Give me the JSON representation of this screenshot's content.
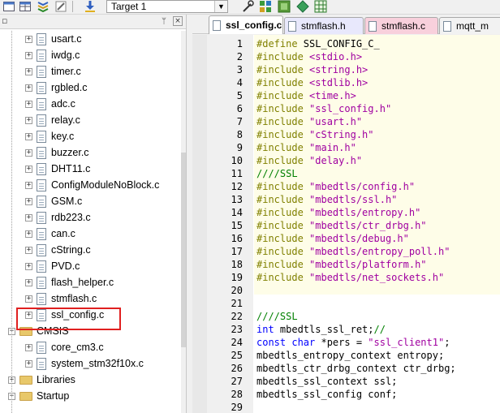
{
  "toolbar": {
    "target_label": "Target 1",
    "dropdown_arrow": "▼"
  },
  "project_panel": {
    "pin_glyph": "ᛘ",
    "close_glyph": "×",
    "tree": [
      {
        "label": "usart.c",
        "kind": "file",
        "level": 2,
        "expander": "+"
      },
      {
        "label": "iwdg.c",
        "kind": "file",
        "level": 2,
        "expander": "+"
      },
      {
        "label": "timer.c",
        "kind": "file",
        "level": 2,
        "expander": "+"
      },
      {
        "label": "rgbled.c",
        "kind": "file",
        "level": 2,
        "expander": "+"
      },
      {
        "label": "adc.c",
        "kind": "file",
        "level": 2,
        "expander": "+"
      },
      {
        "label": "relay.c",
        "kind": "file",
        "level": 2,
        "expander": "+"
      },
      {
        "label": "key.c",
        "kind": "file",
        "level": 2,
        "expander": "+"
      },
      {
        "label": "buzzer.c",
        "kind": "file",
        "level": 2,
        "expander": "+"
      },
      {
        "label": "DHT11.c",
        "kind": "file",
        "level": 2,
        "expander": "+"
      },
      {
        "label": "ConfigModuleNoBlock.c",
        "kind": "file",
        "level": 2,
        "expander": "+"
      },
      {
        "label": "GSM.c",
        "kind": "file",
        "level": 2,
        "expander": "+"
      },
      {
        "label": "rdb223.c",
        "kind": "file",
        "level": 2,
        "expander": "+"
      },
      {
        "label": "can.c",
        "kind": "file",
        "level": 2,
        "expander": "+"
      },
      {
        "label": "cString.c",
        "kind": "file",
        "level": 2,
        "expander": "+"
      },
      {
        "label": "PVD.c",
        "kind": "file",
        "level": 2,
        "expander": "+"
      },
      {
        "label": "flash_helper.c",
        "kind": "file",
        "level": 2,
        "expander": "+"
      },
      {
        "label": "stmflash.c",
        "kind": "file",
        "level": 2,
        "expander": "+"
      },
      {
        "label": "ssl_config.c",
        "kind": "file",
        "level": 2,
        "expander": "+"
      },
      {
        "label": "CMSIS",
        "kind": "folder",
        "level": 1,
        "expander": "−"
      },
      {
        "label": "core_cm3.c",
        "kind": "file",
        "level": 2,
        "expander": "+"
      },
      {
        "label": "system_stm32f10x.c",
        "kind": "file",
        "level": 2,
        "expander": "+"
      },
      {
        "label": "Libraries",
        "kind": "folder",
        "level": 1,
        "expander": "+"
      },
      {
        "label": "Startup",
        "kind": "folder",
        "level": 1,
        "expander": "−"
      }
    ]
  },
  "tabs": [
    {
      "label": "ssl_config.c",
      "active": true,
      "color": "#ffffff"
    },
    {
      "label": "stmflash.h",
      "active": false,
      "color": "#e8e8fc"
    },
    {
      "label": "stmflash.c",
      "active": false,
      "color": "#f8d0dc"
    },
    {
      "label": "mqtt_m",
      "active": false,
      "color": "#f2f2f2"
    }
  ],
  "editor": {
    "lines": [
      {
        "n": "1",
        "parts": [
          [
            "pp",
            "#define "
          ],
          [
            "",
            "SSL_CONFIG_C_"
          ]
        ]
      },
      {
        "n": "2",
        "parts": [
          [
            "pp",
            "#include "
          ],
          [
            "inc",
            "<stdio.h>"
          ]
        ]
      },
      {
        "n": "3",
        "parts": [
          [
            "pp",
            "#include "
          ],
          [
            "inc",
            "<string.h>"
          ]
        ]
      },
      {
        "n": "4",
        "parts": [
          [
            "pp",
            "#include "
          ],
          [
            "inc",
            "<stdlib.h>"
          ]
        ]
      },
      {
        "n": "5",
        "parts": [
          [
            "pp",
            "#include "
          ],
          [
            "inc",
            "<time.h>"
          ]
        ]
      },
      {
        "n": "6",
        "parts": [
          [
            "pp",
            "#include "
          ],
          [
            "str",
            "\"ssl_config.h\""
          ]
        ]
      },
      {
        "n": "7",
        "parts": [
          [
            "pp",
            "#include "
          ],
          [
            "str",
            "\"usart.h\""
          ]
        ]
      },
      {
        "n": "8",
        "parts": [
          [
            "pp",
            "#include "
          ],
          [
            "str",
            "\"cString.h\""
          ]
        ]
      },
      {
        "n": "9",
        "parts": [
          [
            "pp",
            "#include "
          ],
          [
            "str",
            "\"main.h\""
          ]
        ]
      },
      {
        "n": "10",
        "parts": [
          [
            "pp",
            "#include "
          ],
          [
            "str",
            "\"delay.h\""
          ]
        ]
      },
      {
        "n": "11",
        "parts": [
          [
            "cm",
            "////SSL"
          ]
        ]
      },
      {
        "n": "12",
        "parts": [
          [
            "pp",
            "#include "
          ],
          [
            "str",
            "\"mbedtls/config.h\""
          ]
        ]
      },
      {
        "n": "13",
        "parts": [
          [
            "pp",
            "#include "
          ],
          [
            "str",
            "\"mbedtls/ssl.h\""
          ]
        ]
      },
      {
        "n": "14",
        "parts": [
          [
            "pp",
            "#include "
          ],
          [
            "str",
            "\"mbedtls/entropy.h\""
          ]
        ]
      },
      {
        "n": "15",
        "parts": [
          [
            "pp",
            "#include "
          ],
          [
            "str",
            "\"mbedtls/ctr_drbg.h\""
          ]
        ]
      },
      {
        "n": "16",
        "parts": [
          [
            "pp",
            "#include "
          ],
          [
            "str",
            "\"mbedtls/debug.h\""
          ]
        ]
      },
      {
        "n": "17",
        "parts": [
          [
            "pp",
            "#include "
          ],
          [
            "str",
            "\"mbedtls/entropy_poll.h\""
          ]
        ]
      },
      {
        "n": "18",
        "parts": [
          [
            "pp",
            "#include "
          ],
          [
            "str",
            "\"mbedtls/platform.h\""
          ]
        ]
      },
      {
        "n": "19",
        "parts": [
          [
            "pp",
            "#include "
          ],
          [
            "str",
            "\"mbedtls/net_sockets.h\""
          ]
        ]
      },
      {
        "n": "20",
        "parts": []
      },
      {
        "n": "21",
        "parts": []
      },
      {
        "n": "22",
        "parts": [
          [
            "cm",
            "////SSL"
          ]
        ]
      },
      {
        "n": "23",
        "parts": [
          [
            "kw",
            "int "
          ],
          [
            "",
            "mbedtls_ssl_ret;"
          ],
          [
            "cm",
            "//"
          ]
        ]
      },
      {
        "n": "24",
        "parts": [
          [
            "kw",
            "const char "
          ],
          [
            "",
            "*pers = "
          ],
          [
            "str",
            "\"ssl_client1\""
          ],
          [
            "",
            ";"
          ]
        ]
      },
      {
        "n": "25",
        "parts": [
          [
            "",
            "mbedtls_entropy_context entropy;"
          ]
        ]
      },
      {
        "n": "26",
        "parts": [
          [
            "",
            "mbedtls_ctr_drbg_context ctr_drbg;"
          ]
        ]
      },
      {
        "n": "27",
        "parts": [
          [
            "",
            "mbedtls_ssl_context ssl;"
          ]
        ]
      },
      {
        "n": "28",
        "parts": [
          [
            "",
            "mbedtls_ssl_config conf;"
          ]
        ]
      },
      {
        "n": "29",
        "parts": []
      }
    ]
  }
}
